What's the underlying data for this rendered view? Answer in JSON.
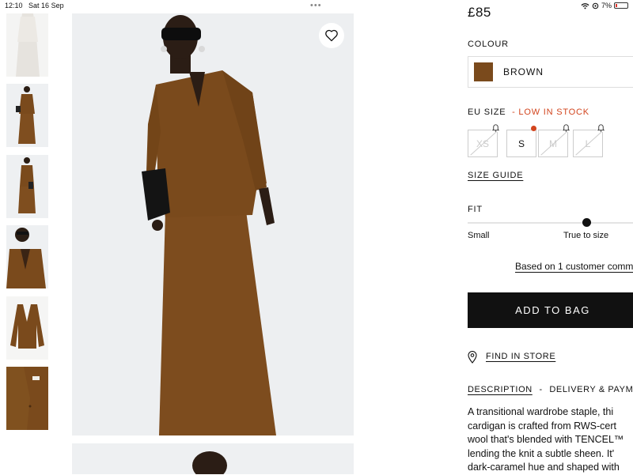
{
  "status_bar": {
    "time": "12:10",
    "date": "Sat 16 Sep",
    "more": "•••",
    "battery": "7%"
  },
  "product": {
    "price": "£85",
    "colour_label": "COLOUR",
    "colour_name": "BROWN",
    "size_label": "EU SIZE",
    "stock_note": "- LOW IN STOCK",
    "sizes": [
      {
        "label": "XS",
        "available": false
      },
      {
        "label": "S",
        "available": true
      },
      {
        "label": "M",
        "available": false
      },
      {
        "label": "L",
        "available": false
      }
    ],
    "size_guide": "SIZE GUIDE",
    "fit_label": "FIT",
    "fit_left": "Small",
    "fit_mid": "True to size",
    "fit_level": 0.5,
    "reviews_link": "Based on 1 customer comm",
    "add_to_bag": "ADD TO BAG",
    "find_in_store": "FIND IN STORE",
    "tabs": {
      "description": "DESCRIPTION",
      "separator": "-",
      "delivery": "DELIVERY & PAYMENT"
    },
    "description_lines": [
      "A transitional wardrobe staple, thi",
      "cardigan is crafted from RWS-cert",
      "wool that's blended with TENCEL™",
      "lending the knit a subtle sheen. It'",
      "dark-caramel hue and shaped with"
    ]
  },
  "icons": [
    "heart-icon",
    "bell-icon",
    "location-pin-icon",
    "wifi-icon",
    "battery-icon"
  ],
  "colors": {
    "brand_text": "#111111",
    "accent_low_stock": "#d2451e",
    "swatch": "#7a4a1c",
    "button_bg": "#111111"
  }
}
